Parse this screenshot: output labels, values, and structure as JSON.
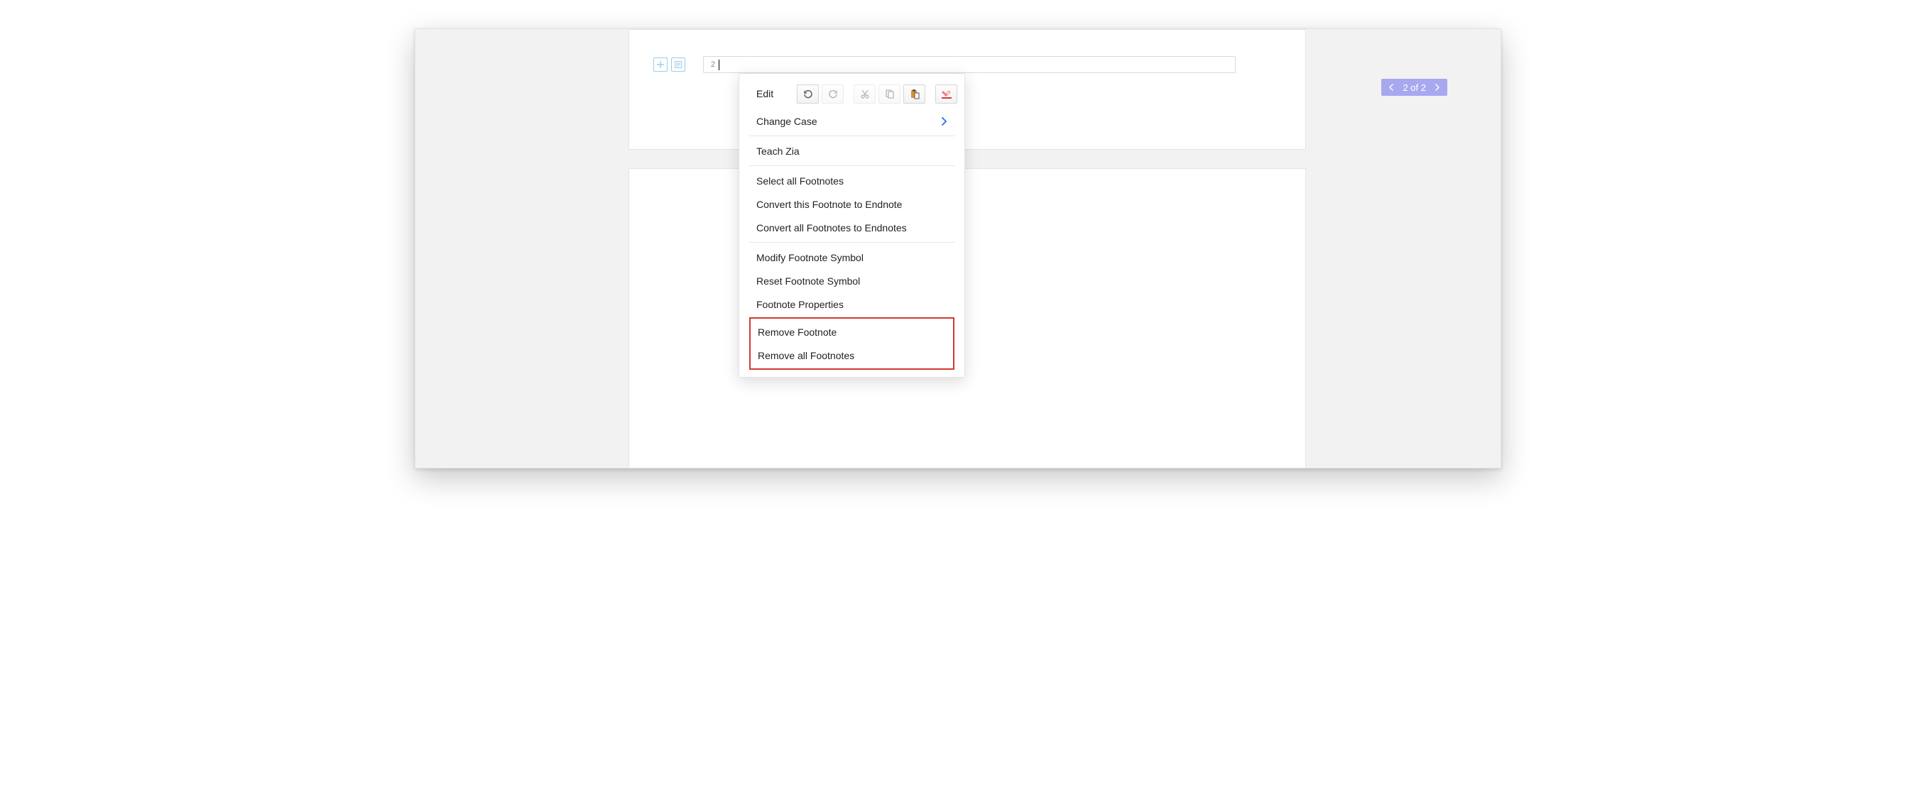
{
  "footnote": {
    "number": "2"
  },
  "pager": {
    "label": "2 of 2"
  },
  "menu": {
    "editLabel": "Edit",
    "changeCase": "Change Case",
    "teachZia": "Teach Zia",
    "selectAll": "Select all Footnotes",
    "convertThis": "Convert this Footnote to Endnote",
    "convertAll": "Convert all Footnotes to Endnotes",
    "modifySymbol": "Modify Footnote Symbol",
    "resetSymbol": "Reset Footnote Symbol",
    "properties": "Footnote Properties",
    "remove": "Remove Footnote",
    "removeAll": "Remove all Footnotes"
  }
}
